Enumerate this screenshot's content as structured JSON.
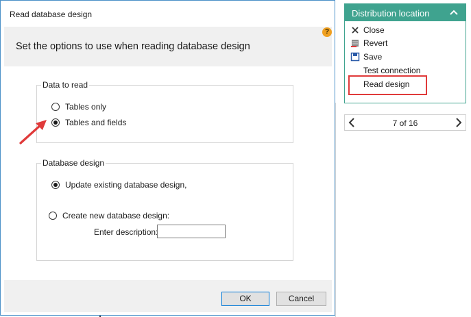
{
  "dialog": {
    "title": "Read database design",
    "instruction": "Set the options to use when reading database design",
    "help_icon": "help-icon",
    "data_group": {
      "legend": "Data to read",
      "options": [
        {
          "label": "Tables only",
          "checked": false
        },
        {
          "label": "Tables and fields",
          "checked": true
        }
      ]
    },
    "design_group": {
      "legend": "Database design",
      "options": [
        {
          "label": "Update existing database design,",
          "checked": true
        },
        {
          "label": "Create new database design:",
          "checked": false
        }
      ],
      "description_label": "Enter description:",
      "description_value": ""
    },
    "buttons": {
      "ok": "OK",
      "cancel": "Cancel"
    }
  },
  "panel": {
    "title": "Distribution location",
    "header_color": "#3fa38f",
    "items": [
      {
        "label": "Close",
        "icon": "close-icon"
      },
      {
        "label": "Revert",
        "icon": "revert-icon"
      },
      {
        "label": "Save",
        "icon": "save-icon"
      },
      {
        "label": "Test connection",
        "icon": ""
      },
      {
        "label": "Read design",
        "icon": ""
      }
    ]
  },
  "pager": {
    "text": "7 of 16"
  },
  "annotation_color": "#e03a3a"
}
